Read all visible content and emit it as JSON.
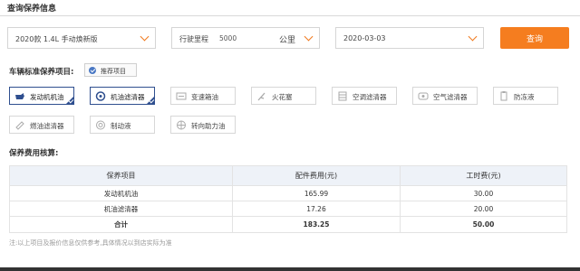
{
  "section_title": "查询保养信息",
  "filters": {
    "car_model": "2020款 1.4L 手动焕新版",
    "mileage_label": "行驶里程",
    "mileage_value": "5000",
    "mileage_unit": "公里",
    "date": "2020-03-03",
    "query_label": "查询"
  },
  "standard": {
    "label": "车辆标准保养项目:",
    "recommend_label": "推荐项目",
    "items": [
      {
        "label": "发动机机油",
        "icon": "oil-can-icon",
        "selected": true
      },
      {
        "label": "机油滤清器",
        "icon": "oil-filter-icon",
        "selected": true
      },
      {
        "label": "变速箱油",
        "icon": "gearbox-oil-icon",
        "selected": false
      },
      {
        "label": "火花塞",
        "icon": "spark-plug-icon",
        "selected": false
      },
      {
        "label": "空调滤清器",
        "icon": "ac-filter-icon",
        "selected": false
      },
      {
        "label": "空气滤清器",
        "icon": "air-filter-icon",
        "selected": false
      },
      {
        "label": "防冻液",
        "icon": "antifreeze-icon",
        "selected": false
      },
      {
        "label": "燃油滤清器",
        "icon": "fuel-filter-icon",
        "selected": false
      },
      {
        "label": "制动液",
        "icon": "brake-fluid-icon",
        "selected": false
      },
      {
        "label": "转向助力油",
        "icon": "power-steering-icon",
        "selected": false
      }
    ]
  },
  "fee": {
    "label": "保养费用核算:",
    "headers": [
      "保养项目",
      "配件费用(元)",
      "工时费(元)"
    ],
    "rows": [
      [
        "发动机机油",
        "165.99",
        "30.00"
      ],
      [
        "机油滤清器",
        "17.26",
        "20.00"
      ]
    ],
    "total": [
      "合计",
      "183.25",
      "50.00"
    ]
  },
  "note": "注:以上项目及报价信息仅供参考,具体情况以到店实际为准",
  "colors": {
    "accent": "#f57d1f",
    "selected_border": "#2f4f8f",
    "header_bg": "#eef2f8"
  }
}
